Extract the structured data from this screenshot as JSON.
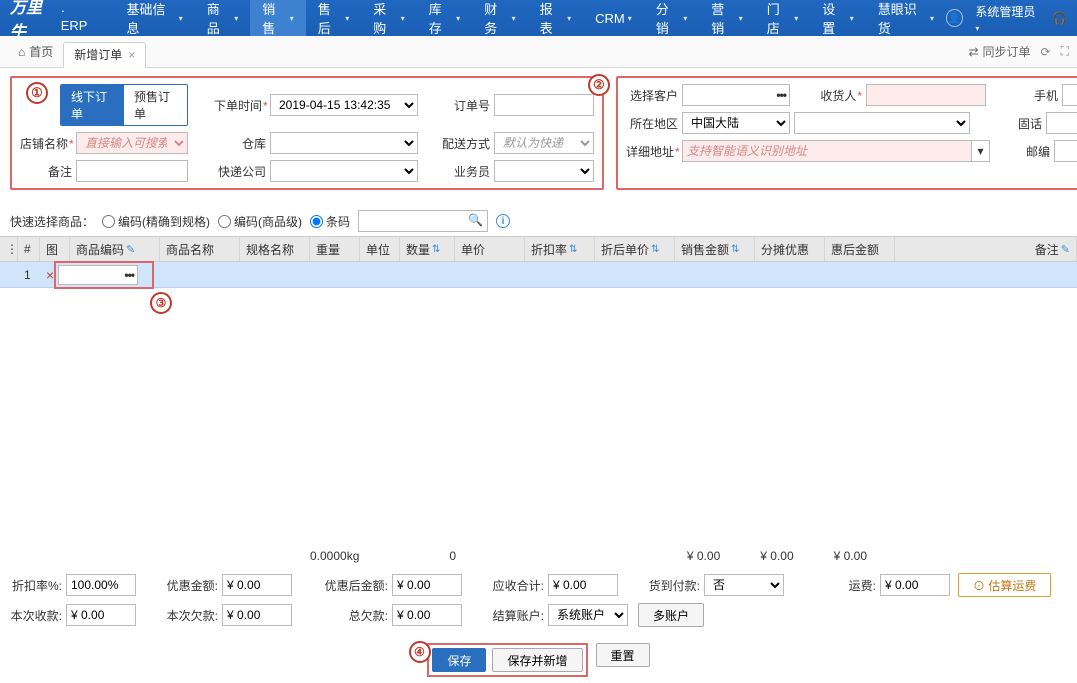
{
  "header": {
    "logo": "万里牛",
    "erp": "· ERP",
    "nav": [
      "基础信息",
      "商品",
      "销售",
      "售后",
      "采购",
      "库存",
      "财务",
      "报表",
      "CRM",
      "分销",
      "营销",
      "门店",
      "设置",
      "慧眼识货"
    ],
    "active_index": 2,
    "user": "系统管理员"
  },
  "tabs": {
    "home": "首页",
    "current": "新增订单",
    "sync": "同步订单"
  },
  "form_left": {
    "toggle_on": "线下订单",
    "toggle_off": "预售订单",
    "order_time_label": "下单时间",
    "order_time_value": "2019-04-15 13:42:35",
    "shop_label": "店铺名称",
    "shop_placeholder": "直接输入可搜索",
    "warehouse_label": "仓库",
    "remark_label": "备注",
    "express_company_label": "快递公司",
    "marker": "①"
  },
  "form_mid": {
    "order_no_label": "订单号",
    "ship_method_label": "配送方式",
    "ship_method_placeholder": "默认为快递",
    "salesman_label": "业务员"
  },
  "form_right": {
    "marker": "②",
    "customer_label": "选择客户",
    "consignee_label": "收货人",
    "mobile_label": "手机",
    "region_label": "所在地区",
    "region_value": "中国大陆",
    "tel_label": "固话",
    "address_label": "详细地址",
    "address_placeholder": "支持智能语义识别地址",
    "postcode_label": "邮编"
  },
  "quick": {
    "label": "快速选择商品：",
    "opt1": "编码(精确到规格)",
    "opt2": "编码(商品级)",
    "opt3": "条码"
  },
  "grid": {
    "cols": [
      "",
      "#",
      "图",
      "商品编码",
      "商品名称",
      "规格名称",
      "重量",
      "单位",
      "数量",
      "单价",
      "折扣率",
      "折后单价",
      "销售金额",
      "分摊优惠",
      "惠后金额",
      "备注"
    ],
    "row_index": "1",
    "marker": "③"
  },
  "totals": {
    "weight": "0.0000kg",
    "qty": "0",
    "amt1": "¥ 0.00",
    "amt2": "¥ 0.00",
    "amt3": "¥ 0.00"
  },
  "footer": {
    "discount_rate_label": "折扣率%:",
    "discount_rate_value": "100.00%",
    "discount_amt_label": "优惠金额:",
    "zero": "¥ 0.00",
    "after_discount_label": "优惠后金额:",
    "receivable_label": "应收合计:",
    "cod_label": "货到付款:",
    "cod_value": "否",
    "freight_label": "运费:",
    "est_freight_btn": "估算运费",
    "this_receipt_label": "本次收款:",
    "this_owe_label": "本次欠款:",
    "total_owe_label": "总欠款:",
    "settle_acct_label": "结算账户:",
    "settle_acct_value": "系统账户",
    "multi_acct_btn": "多账户",
    "save": "保存",
    "save_add": "保存并新增",
    "reset": "重置",
    "marker": "④"
  }
}
